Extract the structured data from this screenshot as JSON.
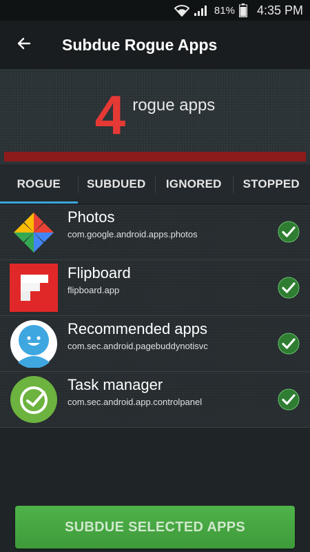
{
  "status_bar": {
    "battery_percent": "81%",
    "time": "4:35 PM"
  },
  "app_bar": {
    "title": "Subdue Rogue Apps"
  },
  "summary": {
    "count": "4",
    "label": "rogue apps"
  },
  "tabs": [
    {
      "label": "ROGUE",
      "active": true
    },
    {
      "label": "SUBDUED",
      "active": false
    },
    {
      "label": "IGNORED",
      "active": false
    },
    {
      "label": "STOPPED",
      "active": false
    }
  ],
  "apps": [
    {
      "name": "Photos",
      "package": "com.google.android.apps.photos",
      "icon": "photos-icon",
      "checked": true
    },
    {
      "name": "Flipboard",
      "package": "flipboard.app",
      "icon": "flipboard-icon",
      "checked": true
    },
    {
      "name": "Recommended apps",
      "package": "com.sec.android.pagebuddynotisvc",
      "icon": "recommended-apps-icon",
      "checked": true
    },
    {
      "name": "Task manager",
      "package": "com.sec.android.app.controlpanel",
      "icon": "task-manager-icon",
      "checked": true
    }
  ],
  "action_button": {
    "label": "SUBDUE SELECTED APPS"
  },
  "colors": {
    "accent_red": "#e53935",
    "tab_indicator": "#3aa6dd",
    "button_green": "#4caf50",
    "check_green": "#2e7d32"
  }
}
